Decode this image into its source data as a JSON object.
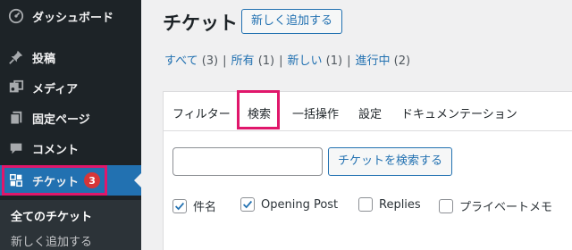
{
  "sidebar": {
    "items": [
      {
        "label": "ダッシュボード",
        "icon": "dashboard-icon"
      },
      {
        "label": "投稿",
        "icon": "pin-icon"
      },
      {
        "label": "メディア",
        "icon": "media-icon"
      },
      {
        "label": "固定ページ",
        "icon": "pages-icon"
      },
      {
        "label": "コメント",
        "icon": "comment-icon"
      },
      {
        "label": "チケット",
        "icon": "ticket-icon",
        "badge": "3"
      }
    ],
    "submenu": [
      "全てのチケット",
      "新しく追加する"
    ]
  },
  "header": {
    "title": "チケット",
    "add_new": "新しく追加する"
  },
  "views": [
    {
      "label": "すべて",
      "count": "(3)"
    },
    {
      "label": "所有",
      "count": "(1)"
    },
    {
      "label": "新しい",
      "count": "(1)"
    },
    {
      "label": "進行中",
      "count": "(2)"
    }
  ],
  "tabs": [
    "フィルター",
    "検索",
    "一括操作",
    "設定",
    "ドキュメンテーション"
  ],
  "search": {
    "value": "",
    "button": "チケットを検索する"
  },
  "fields": [
    {
      "label": "件名",
      "checked": true
    },
    {
      "label": "Opening Post",
      "checked": true
    },
    {
      "label": "Replies",
      "checked": false
    },
    {
      "label": "プライベートメモ",
      "checked": false
    }
  ],
  "colors": {
    "sidebar_bg": "#1d2327",
    "accent": "#2271b1",
    "badge": "#d63638",
    "highlight": "#e0176b"
  }
}
